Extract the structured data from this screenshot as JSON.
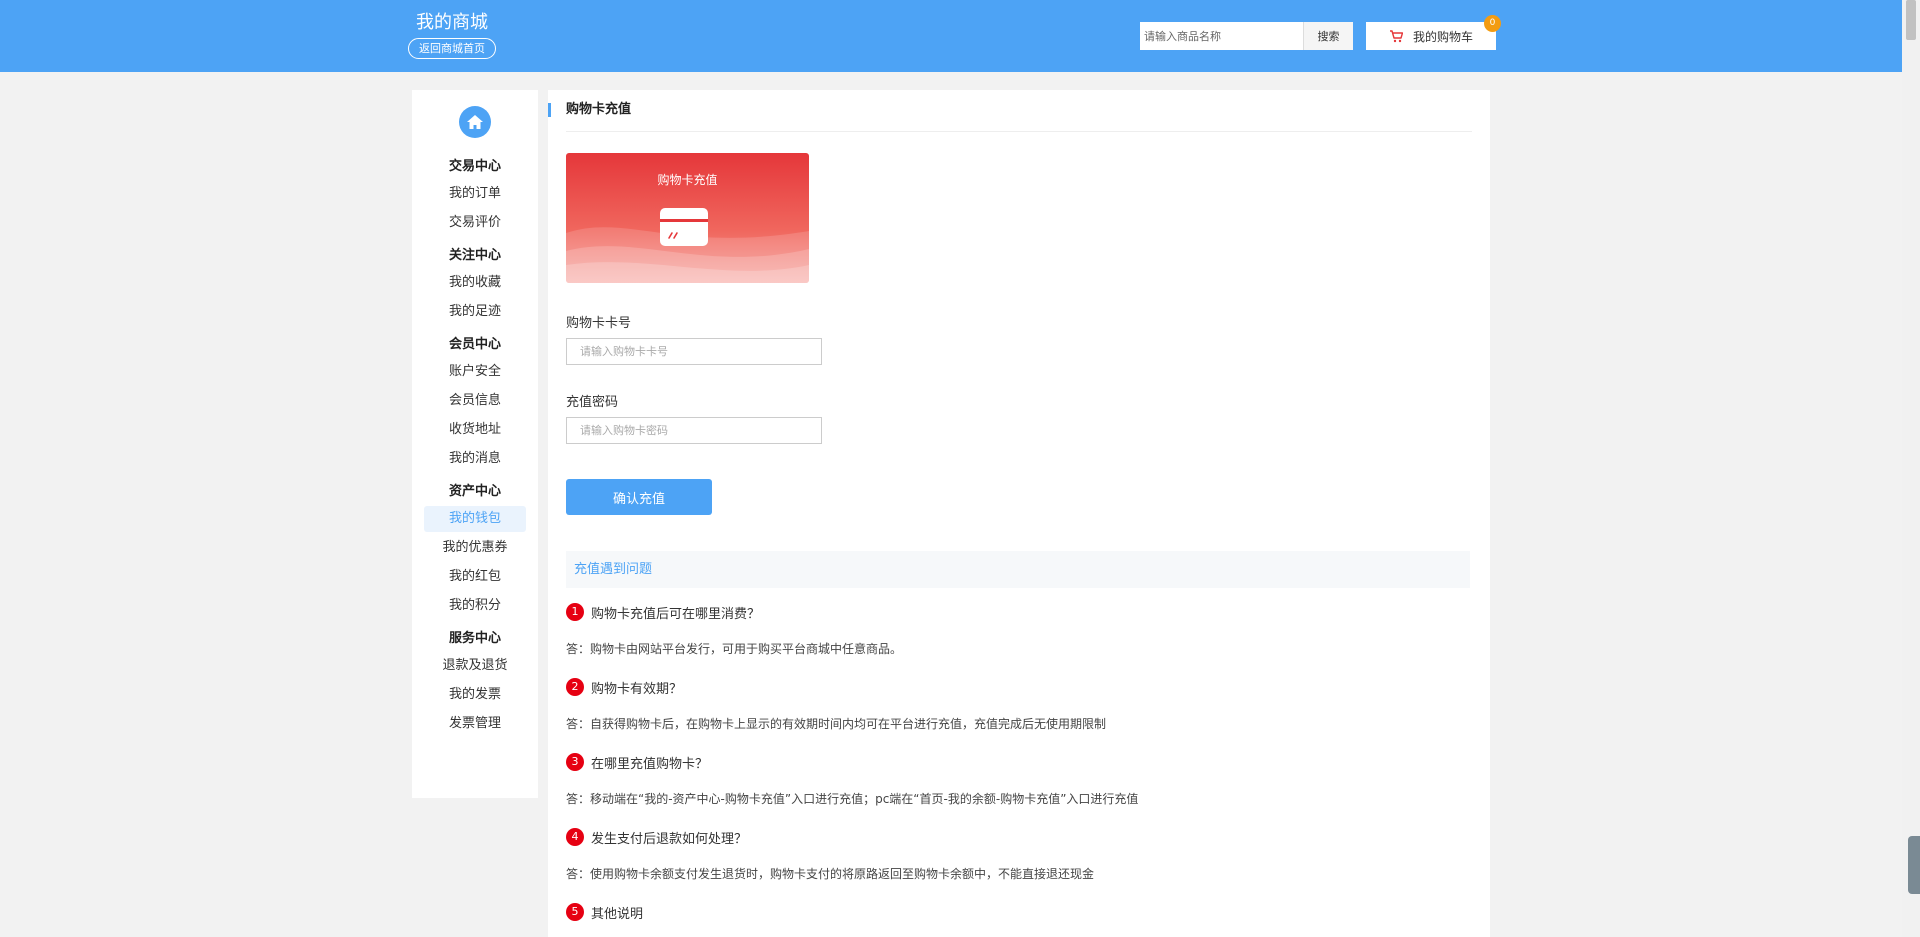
{
  "header": {
    "brand_title": "我的商城",
    "home_link": "返回商城首页",
    "search_placeholder": "请输入商品名称",
    "search_button": "搜索",
    "cart_label": "我的购物车",
    "cart_count": "0"
  },
  "sidebar": {
    "groups": [
      {
        "title": "交易中心",
        "items": [
          "我的订单",
          "交易评价"
        ]
      },
      {
        "title": "关注中心",
        "items": [
          "我的收藏",
          "我的足迹"
        ]
      },
      {
        "title": "会员中心",
        "items": [
          "账户安全",
          "会员信息",
          "收货地址",
          "我的消息"
        ]
      },
      {
        "title": "资产中心",
        "items": [
          "我的钱包",
          "我的优惠券",
          "我的红包",
          "我的积分"
        ]
      },
      {
        "title": "服务中心",
        "items": [
          "退款及退货",
          "我的发票",
          "发票管理"
        ]
      }
    ],
    "active_item": "我的钱包"
  },
  "main": {
    "title": "购物卡充值",
    "card_title": "购物卡充值",
    "card_number_label": "购物卡卡号",
    "card_number_placeholder": "请输入购物卡卡号",
    "password_label": "充值密码",
    "password_placeholder": "请输入购物卡密码",
    "confirm_button": "确认充值",
    "faq_heading": "充值遇到问题",
    "faq": [
      {
        "num": "1",
        "q": "购物卡充值后可在哪里消费？",
        "a": "答：购物卡由网站平台发行，可用于购买平台商城中任意商品。"
      },
      {
        "num": "2",
        "q": "购物卡有效期？",
        "a": "答：自获得购物卡后，在购物卡上显示的有效期时间内均可在平台进行充值，充值完成后无使用期限制"
      },
      {
        "num": "3",
        "q": "在哪里充值购物卡？",
        "a": "答：移动端在“我的-资产中心-购物卡充值”入口进行充值；pc端在“首页-我的余额-购物卡充值”入口进行充值"
      },
      {
        "num": "4",
        "q": "发生支付后退款如何处理？",
        "a": "答：使用购物卡余额支付发生退货时，购物卡支付的将原路返回至购物卡余额中，不能直接退还现金"
      },
      {
        "num": "5",
        "q": "其他说明",
        "a": ""
      }
    ]
  },
  "colors": {
    "accent": "#4da3f5",
    "card_red": "#e5373a",
    "faq_number": "#e60012",
    "cart_badge": "#f39c12"
  }
}
